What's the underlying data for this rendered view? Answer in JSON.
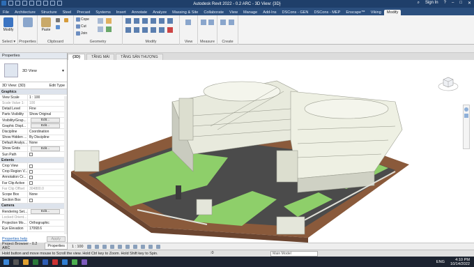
{
  "window": {
    "title": "Autodesk Revit 2022 - 0.2 ARC - 3D View: {3D}",
    "sign_in": "Sign In"
  },
  "ribbon_tabs": [
    "File",
    "Architecture",
    "Structure",
    "Steel",
    "Precast",
    "Systems",
    "Insert",
    "Annotate",
    "Analyze",
    "Massing & Site",
    "Collaborate",
    "View",
    "Manage",
    "Add-Ins",
    "DSCons - GEN",
    "DSCons - MEP",
    "Enscape™",
    "Viking",
    "Modify"
  ],
  "ribbon_active_tab": "Modify",
  "ribbon": {
    "modify_label": "Modify",
    "paste_label": "Paste",
    "cope_label": "Cope",
    "cut_label": "Cut",
    "join_label": "Join",
    "groups": {
      "select": "Select ▾",
      "properties": "Properties",
      "clipboard": "Clipboard",
      "geometry": "Geometry",
      "modify": "Modify",
      "view": "View",
      "measure": "Measure",
      "create": "Create"
    }
  },
  "view_tabs": [
    {
      "label": "{3D}",
      "active": true
    },
    {
      "label": "TẦNG MÁI",
      "active": false
    },
    {
      "label": "TẦNG SÂN THƯỢNG",
      "active": false
    }
  ],
  "properties": {
    "title": "Properties",
    "type_name": "3D View",
    "instance": "3D View: {3D}",
    "edit_type": "Edit Type",
    "rows": [
      {
        "k": "Graphics",
        "section": true
      },
      {
        "k": "View Scale",
        "v": "1 : 100"
      },
      {
        "k": "Scale Value   1:",
        "v": "100",
        "muted": true
      },
      {
        "k": "Detail Level",
        "v": "Fine"
      },
      {
        "k": "Parts Visibility",
        "v": "Show Original"
      },
      {
        "k": "Visibility/Grap...",
        "btn": "Edit..."
      },
      {
        "k": "Graphic Displ...",
        "btn": "Edit..."
      },
      {
        "k": "Discipline",
        "v": "Coordination"
      },
      {
        "k": "Show Hidden ...",
        "v": "By Discipline"
      },
      {
        "k": "Default Analys...",
        "v": "None"
      },
      {
        "k": "Show Grids",
        "btn": "Edit..."
      },
      {
        "k": "Sun Path",
        "cb": true
      },
      {
        "k": "Extents",
        "section": true
      },
      {
        "k": "Crop View",
        "cb": true
      },
      {
        "k": "Crop Region V...",
        "cb": true
      },
      {
        "k": "Annotation Cr...",
        "cb": true
      },
      {
        "k": "Far Clip Active",
        "cb": true
      },
      {
        "k": "Far Clip Offset",
        "v": "304800.0",
        "muted": true
      },
      {
        "k": "Scope Box",
        "v": "None"
      },
      {
        "k": "Section Box",
        "cb": true
      },
      {
        "k": "Camera",
        "section": true
      },
      {
        "k": "Rendering Set...",
        "btn": "Edit..."
      },
      {
        "k": "Locked Orient...",
        "muted": true
      },
      {
        "k": "Projection Mo...",
        "v": "Orthographic"
      },
      {
        "k": "Eye Elevation",
        "v": "17068.6"
      }
    ],
    "help": "Properties help",
    "apply": "Apply"
  },
  "bottom_tabs": [
    "Project Browser - 0.2 ARC",
    "Properties"
  ],
  "view_control": {
    "scale": "1 : 100"
  },
  "status": {
    "message": "Hold button and move mouse to Scroll the view. Hold Ctrl key to Zoom. Hold Shift key to Spin.",
    "zero": ":0",
    "model": "Main Model"
  },
  "taskbar": {
    "lang": "ENG",
    "time": "4:10 PM",
    "date": "10/14/2022"
  },
  "colors": {
    "title_blue": "#1f3f6a",
    "grass": "#8ecf6a",
    "road": "#4b4b4b",
    "ground_brown": "#8a5a3b"
  }
}
